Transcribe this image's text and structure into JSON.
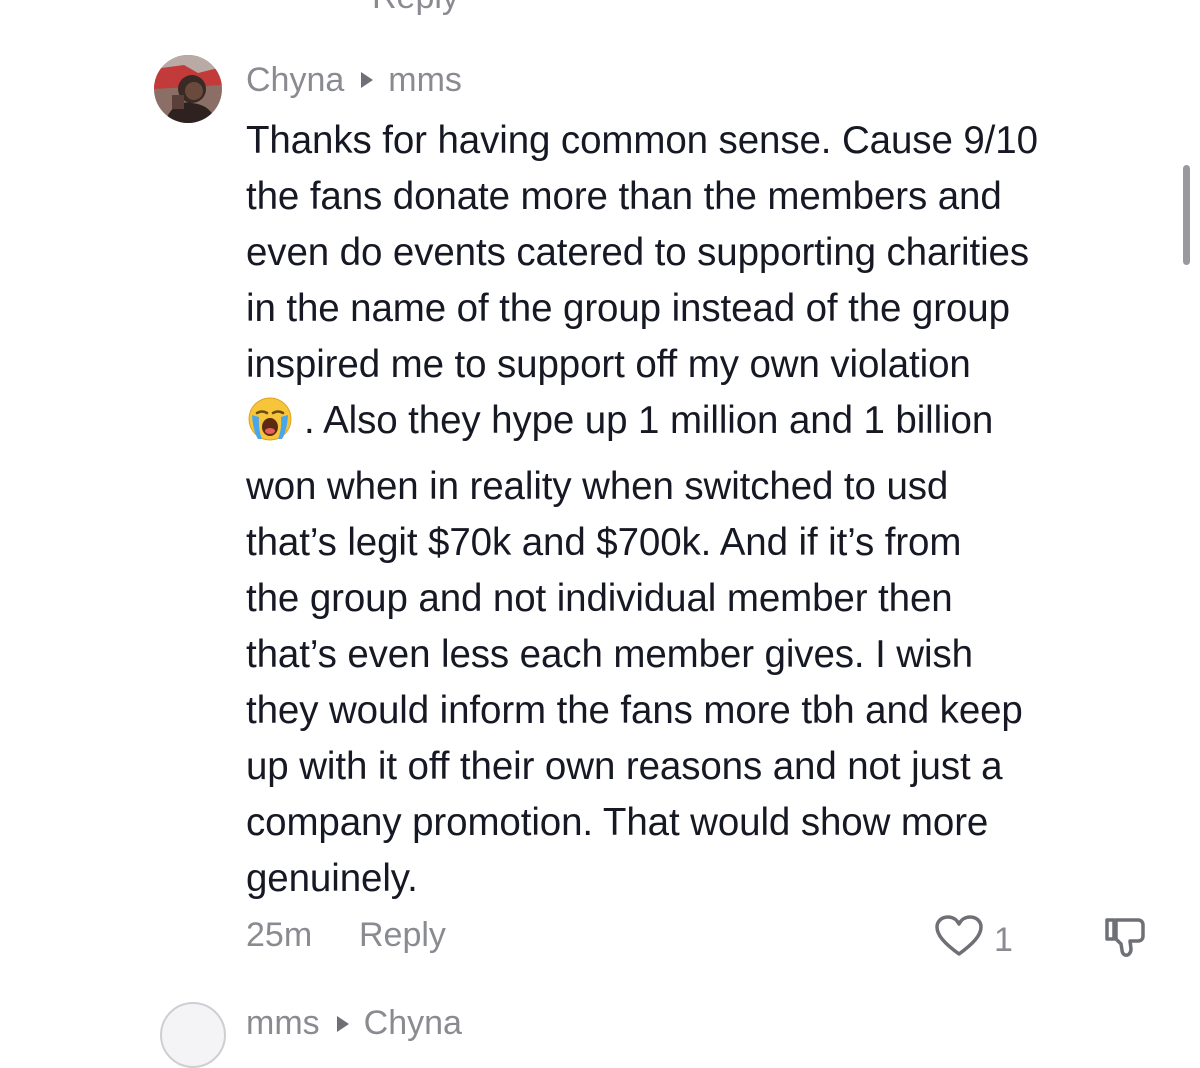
{
  "top_fragment": {
    "reply_label": "Reply"
  },
  "comment": {
    "author": "Chyna",
    "reply_to": "mms",
    "lines": [
      "Thanks for having common sense. Cause 9/10",
      "the fans donate more than the members and",
      "even do events catered to supporting charities",
      "in the name of the group instead of the group",
      "inspired me to support off my own violation",
      ". Also they hype up 1 million and 1 billion",
      "won when in reality when switched to usd",
      "that’s legit $70k and $700k. And if it’s from",
      "the group and not individual member then",
      "that’s even less each member gives. I wish",
      "they would inform the fans more tbh and keep",
      "up with it off their own reasons and not just a",
      "company promotion. That would show more",
      "genuinely."
    ],
    "emoji": "loudly-crying-face",
    "time": "25m",
    "reply_label": "Reply",
    "like_count": "1"
  },
  "next_comment": {
    "author": "mms",
    "reply_to": "Chyna"
  },
  "colors": {
    "text": "#161823",
    "meta": "#8a8b91",
    "icon": "#6f7076",
    "scrollbar": "#9a9a9e"
  }
}
